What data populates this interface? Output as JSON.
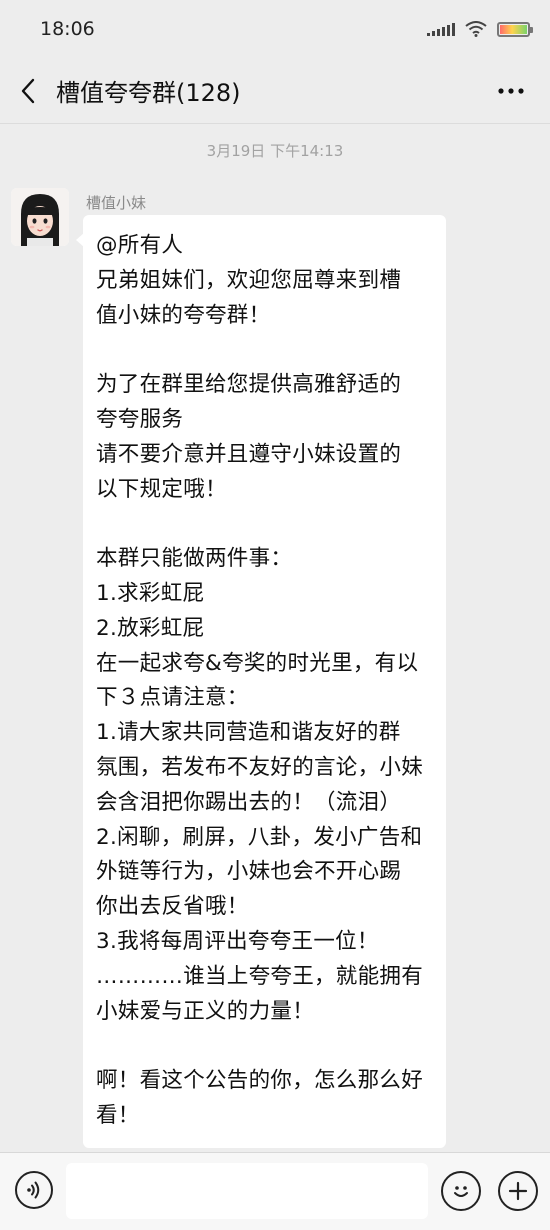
{
  "status_bar": {
    "time": "18:06",
    "icons": [
      "signal-icon",
      "wifi-icon",
      "battery-icon"
    ]
  },
  "header": {
    "title": "槽值夸夸群(128)",
    "back_icon": "back-arrow-icon",
    "more_icon": "more-dots-icon"
  },
  "chat": {
    "timestamp": "3月19日 下午14:13",
    "message": {
      "sender": "槽值小妹",
      "lines": [
        "@所有人",
        "兄弟姐妹们，欢迎您屈尊来到槽",
        "值小妹的夸夸群！",
        "",
        "为了在群里给您提供高雅舒适的",
        "夸夸服务",
        "请不要介意并且遵守小妹设置的",
        "以下规定哦！",
        "",
        "本群只能做两件事：",
        "1.求彩虹屁",
        "2.放彩虹屁",
        "在一起求夸&夸奖的时光里，有以",
        "下３点请注意：",
        "1.请大家共同营造和谐友好的群",
        "氛围，若发布不友好的言论，小妹",
        "会含泪把你踢出去的！（流泪）",
        "2.闲聊，刷屏，八卦，发小广告和",
        "外链等行为，小妹也会不开心踢",
        "你出去反省哦！",
        "3.我将每周评出夸夸王一位！",
        "…………谁当上夸夸王，就能拥有",
        "小妹爱与正义的力量！",
        "",
        "啊！看这个公告的你，怎么那么好",
        "看！"
      ]
    }
  },
  "input_bar": {
    "value": "",
    "voice_icon": "voice-icon",
    "emoji_icon": "emoji-icon",
    "plus_icon": "plus-icon"
  }
}
